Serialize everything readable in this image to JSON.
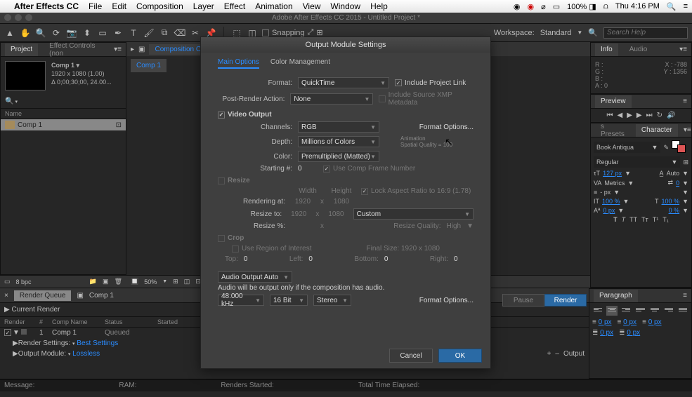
{
  "menubar": {
    "items": [
      "After Effects CC",
      "File",
      "Edit",
      "Composition",
      "Layer",
      "Effect",
      "Animation",
      "View",
      "Window",
      "Help"
    ],
    "right": {
      "battery": "100%",
      "day": "Thu",
      "time": "4:16 PM"
    }
  },
  "titlebar": "Adobe After Effects CC 2015 - Untitled Project *",
  "toolbar": {
    "snapping": "Snapping",
    "workspace_label": "Workspace:",
    "workspace_value": "Standard",
    "search_placeholder": "Search Help"
  },
  "project": {
    "tab1": "Project",
    "tab2": "Effect Controls (non",
    "comp_name": "Comp 1 ▾",
    "meta1": "1920 x 1080 (1.00)",
    "meta2": "Δ 0;00;30;00, 24.00...",
    "col_name": "Name",
    "item": "Comp 1",
    "bpc": "8 bpc"
  },
  "comp": {
    "tab": "Composition Comp 1",
    "subtab": "Comp 1",
    "zoom": "50%"
  },
  "info": {
    "title": "Info",
    "audio_tab": "Audio",
    "r": "R :",
    "g": "G :",
    "b": "B :",
    "a": "A : 0",
    "x": "X : -788",
    "y": "Y : 1356"
  },
  "preview": {
    "title": "Preview"
  },
  "char": {
    "title": "Character",
    "presets_tab": "s Presets",
    "font": "Book Antiqua",
    "style": "Regular",
    "size": "127 px",
    "leading": "Auto",
    "metrics": "Metrics",
    "track": "0",
    "scale_v": "- px",
    "scale1": "100 %",
    "scale2": "100 %",
    "baseline": "0 px",
    "stroke": "0 %"
  },
  "para": {
    "title": "Paragraph",
    "v": "0 px"
  },
  "timeline": {
    "rq_tab": "Render Queue",
    "comp_tab": "Comp 1",
    "current_render": "Current Render",
    "cols": {
      "render": "Render",
      "num": "#",
      "name": "Comp Name",
      "status": "Status",
      "started": "Started"
    },
    "row": {
      "num": "1",
      "name": "Comp 1",
      "status": "Queued"
    },
    "rs_label": "Render Settings:",
    "rs_val": "Best Settings",
    "om_label": "Output Module:",
    "om_val": "Lossless",
    "out_label": "Output",
    "pause": "Pause",
    "render": "Render"
  },
  "footer": {
    "msg": "Message:",
    "ram": "RAM:",
    "rs": "Renders Started:",
    "tte": "Total Time Elapsed:"
  },
  "modal": {
    "title": "Output Module Settings",
    "tab_main": "Main Options",
    "tab_color": "Color Management",
    "format_label": "Format:",
    "format_value": "QuickTime",
    "incl_link": "Include Project Link",
    "pra_label": "Post-Render Action:",
    "pra_value": "None",
    "incl_xmp": "Include Source XMP Metadata",
    "video_output": "Video Output",
    "channels_label": "Channels:",
    "channels_value": "RGB",
    "fmt_options": "Format Options...",
    "depth_label": "Depth:",
    "depth_value": "Millions of Colors",
    "anim_line1": "Animation",
    "anim_line2": "Spatial Quality = 100",
    "color_label": "Color:",
    "color_value": "Premultiplied (Matted)",
    "start_label": "Starting #:",
    "start_value": "0",
    "use_comp": "Use Comp Frame Number",
    "resize": "Resize",
    "width": "Width",
    "height": "Height",
    "lock_aspect": "Lock Aspect Ratio to 16:9 (1.78)",
    "rendering_at": "Rendering at:",
    "ra_w": "1920",
    "x": "x",
    "ra_h": "1080",
    "resize_to": "Resize to:",
    "rt_w": "1920",
    "rt_h": "1080",
    "custom": "Custom",
    "resize_pct": "Resize %:",
    "rp_x": "x",
    "rq_label": "Resize Quality:",
    "rq_value": "High",
    "crop": "Crop",
    "roi": "Use Region of Interest",
    "final_size": "Final Size: 1920 x 1080",
    "top": "Top:",
    "top_v": "0",
    "left": "Left:",
    "left_v": "0",
    "bottom": "Bottom:",
    "bottom_v": "0",
    "right": "Right:",
    "right_v": "0",
    "audio_out": "Audio Output Auto",
    "audio_note": "Audio will be output only if the composition has audio.",
    "a_rate": "48.000 kHz",
    "a_bit": "16 Bit",
    "a_ch": "Stereo",
    "cancel": "Cancel",
    "ok": "OK"
  }
}
